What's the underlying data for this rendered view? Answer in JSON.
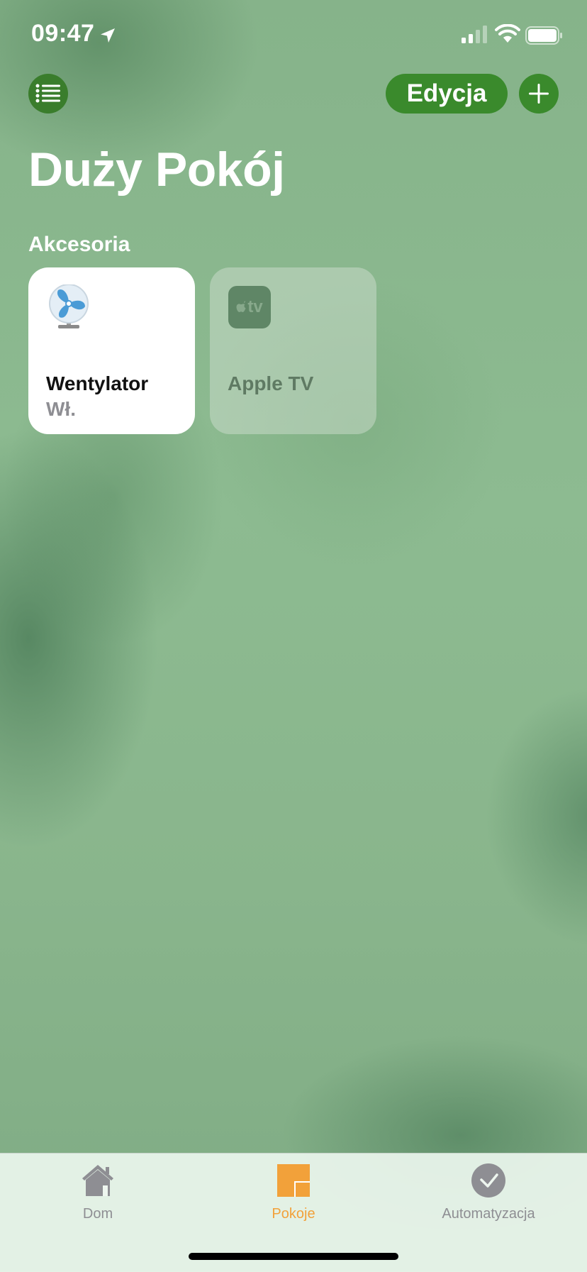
{
  "status_bar": {
    "time": "09:47",
    "icons": [
      "location-arrow-icon",
      "signal-icon",
      "wifi-icon",
      "battery-icon"
    ]
  },
  "header": {
    "menu_icon": "list-icon",
    "edit_label": "Edycja",
    "add_icon": "plus-icon",
    "title": "Duży Pokój"
  },
  "section": {
    "label": "Akcesoria"
  },
  "accessories": [
    {
      "name": "Wentylator",
      "status": "Wł.",
      "icon": "fan-icon",
      "active": true
    },
    {
      "name": "Apple TV",
      "badge": "tv",
      "icon": "apple-tv-icon",
      "active": false
    }
  ],
  "tab_bar": {
    "tabs": [
      {
        "label": "Dom",
        "icon": "house-icon",
        "selected": false
      },
      {
        "label": "Pokoje",
        "icon": "rooms-icon",
        "selected": true
      },
      {
        "label": "Automatyzacja",
        "icon": "automation-icon",
        "selected": false
      }
    ]
  },
  "colors": {
    "accent_green": "#3a8a2c",
    "selected_tab": "#f2a13a",
    "background": "#8fb890"
  }
}
